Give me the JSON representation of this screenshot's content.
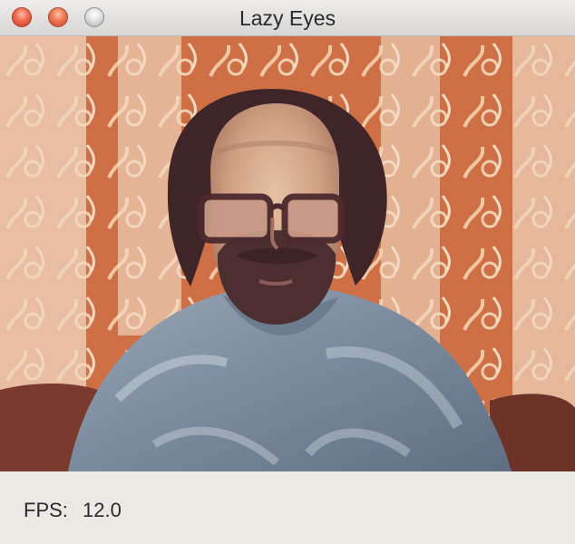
{
  "window": {
    "title": "Lazy Eyes"
  },
  "status": {
    "fps_label": "FPS:",
    "fps_value": "12.0"
  },
  "colors": {
    "close": "#ee6a4e",
    "minimize": "#ed7652",
    "zoom": "#dcdcdc"
  }
}
